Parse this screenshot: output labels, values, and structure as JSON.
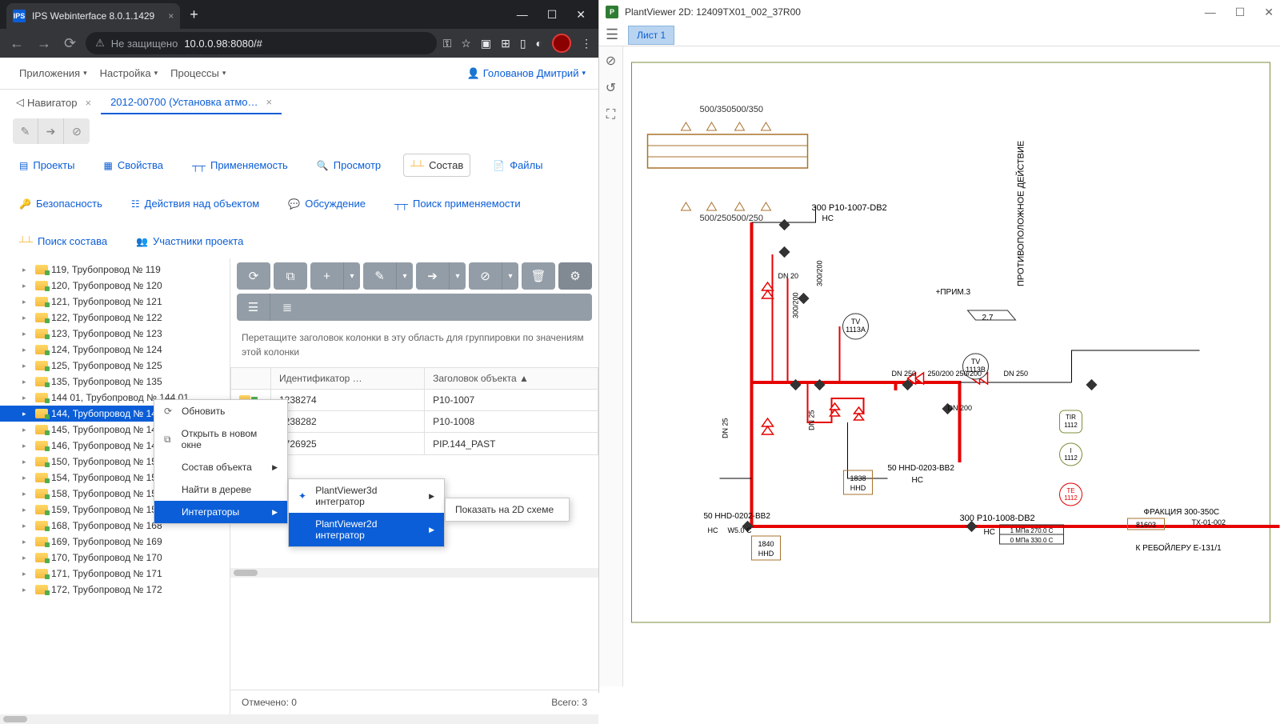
{
  "browser": {
    "tab_title": "IPS Webinterface 8.0.1.1429",
    "url_label": "Не защищено",
    "url": "10.0.0.98:8080/#"
  },
  "app_menu": {
    "apps": "Приложения",
    "settings": "Настройка",
    "processes": "Процессы",
    "user": "Голованов Дмитрий"
  },
  "app_tabs": {
    "navigator": "Навигатор",
    "detail": "2012-00700 (Установка атмо…"
  },
  "sub_tabs": {
    "projects": "Проекты",
    "props": "Свойства",
    "apply": "Применяемость",
    "view": "Просмотр",
    "composition": "Состав",
    "files": "Файлы",
    "security": "Безопасность",
    "obj_actions": "Действия над объектом",
    "discussion": "Обсуждение",
    "apply_search": "Поиск применяемости",
    "comp_search": "Поиск состава",
    "members": "Участники проекта"
  },
  "tree": [
    "119, Трубопровод № 119",
    "120, Трубопровод № 120",
    "121, Трубопровод № 121",
    "122, Трубопровод № 122",
    "123, Трубопровод № 123",
    "124, Трубопровод № 124",
    "125, Трубопровод № 125",
    "135, Трубопровод № 135",
    "144 01, Трубопровод № 144 01",
    "144, Трубопровод № 144",
    "145, Трубопровод № 145",
    "146, Трубопровод № 146",
    "150, Трубопровод № 150",
    "154, Трубопровод № 154",
    "158, Трубопровод № 158",
    "159, Трубопровод № 159",
    "168, Трубопровод № 168",
    "169, Трубопровод № 169",
    "170, Трубопровод № 170",
    "171, Трубопровод № 171",
    "172, Трубопровод № 172"
  ],
  "tree_selected_index": 9,
  "detail": {
    "group_hint": "Перетащите заголовок колонки в эту область для группировки по значениям этой колонки",
    "col_id": "Идентификатор …",
    "col_title": "Заголовок объекта ▲",
    "rows": [
      {
        "id": "1238274",
        "title": "P10-1007"
      },
      {
        "id": "1238282",
        "title": "P10-1008"
      },
      {
        "id": "1726925",
        "title": "PIP.144_PAST"
      }
    ],
    "footer_checked": "Отмечено: 0",
    "footer_total": "Всего: 3"
  },
  "context_menu": {
    "refresh": "Обновить",
    "open_new": "Открыть в новом окне",
    "composition": "Состав объекта",
    "find_tree": "Найти в дереве",
    "integrators": "Интеграторы"
  },
  "submenu": {
    "pv3d": "PlantViewer3d интегратор",
    "pv2d": "PlantViewer2d интегратор"
  },
  "submenu2": {
    "show2d": "Показать на 2D схеме"
  },
  "plantviewer": {
    "title": "PlantViewer 2D: 12409TX01_002_37R00",
    "sheet": "Лист 1",
    "labels": {
      "top1": "500/350500/350",
      "top2": "500/250500/250",
      "pipe1": "300 P10-1007-DB2",
      "pipe2": "300 P10-1008-DB2",
      "hc": "HC",
      "dn20": "DN 20",
      "dn25": "DN 25",
      "dn200": "DN 200",
      "dn250_1": "DN 250",
      "dn250_2": "250/200",
      "dn250_3": "DN 250",
      "tv1": "TV",
      "tv1n": "1113A",
      "tv2": "TV",
      "tv2n": "1113B",
      "tir": "TIR",
      "tir_n": "1112",
      "i_lbl": "I",
      "te": "TE",
      "vert300": "300/200",
      "vert3002": "300/200",
      "hhd1": "50 HHD-0202-BB2",
      "hhd2": "50 HHD-0203-BB2",
      "box1": "1840",
      "box1b": "HHD",
      "box2": "1838",
      "box2b": "HHD",
      "hcw": "HC",
      "w50": "W5.0 C",
      "prim": "+ПРИМ.3",
      "num27": "2.7",
      "vert_text": "ПРОТИВОПОЛОЖНОЕ ДЕЙСТВИЕ",
      "frak": "ФРАКЦИЯ 300-350С",
      "frak2": "ТХ-01-002",
      "reboil": "К РЕБОЙЛЕРУ Е-131/1",
      "stream": "81603",
      "p1": "1 МПа 270.0 С",
      "p2": "0 МПа 330.0 С"
    }
  }
}
